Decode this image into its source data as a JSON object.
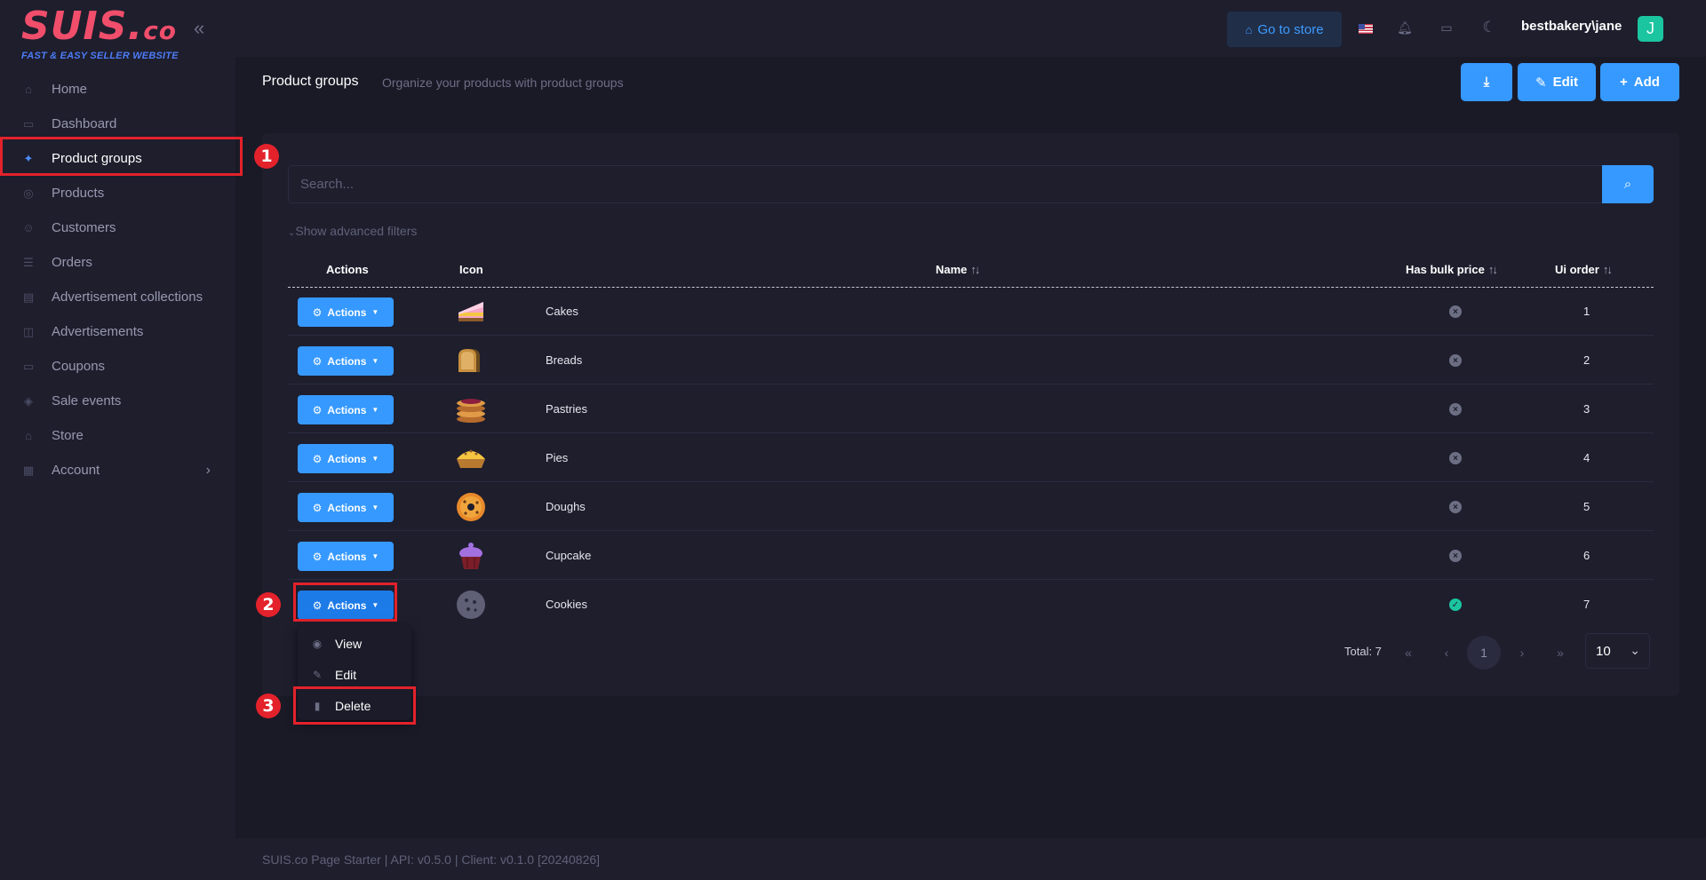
{
  "brand": {
    "logo_main": "SUIS.",
    "logo_co": "co",
    "tagline": "FAST & EASY SELLER WEBSITE"
  },
  "sidebar": {
    "items": [
      {
        "label": "Home",
        "icon": "home-icon"
      },
      {
        "label": "Dashboard",
        "icon": "dashboard-icon"
      },
      {
        "label": "Product groups",
        "icon": "product-groups-icon",
        "active": true
      },
      {
        "label": "Products",
        "icon": "products-icon"
      },
      {
        "label": "Customers",
        "icon": "customers-icon"
      },
      {
        "label": "Orders",
        "icon": "orders-icon"
      },
      {
        "label": "Advertisement collections",
        "icon": "ad-collections-icon"
      },
      {
        "label": "Advertisements",
        "icon": "advertisements-icon"
      },
      {
        "label": "Coupons",
        "icon": "coupons-icon"
      },
      {
        "label": "Sale events",
        "icon": "sale-events-icon"
      },
      {
        "label": "Store",
        "icon": "store-icon"
      },
      {
        "label": "Account",
        "icon": "account-icon"
      }
    ]
  },
  "topbar": {
    "store_label": "Go to store",
    "username": "bestbakery\\jane",
    "avatar_letter": "J"
  },
  "page": {
    "title": "Product groups",
    "subtitle": "Organize your products with product groups",
    "edit_label": "Edit",
    "add_label": "Add"
  },
  "search": {
    "placeholder": "Search...",
    "advanced_filters": "Show advanced filters"
  },
  "table": {
    "columns": {
      "actions": "Actions",
      "icon": "Icon",
      "name": "Name",
      "bulk": "Has bulk price",
      "order": "Ui order"
    },
    "action_label": "Actions",
    "rows": [
      {
        "name": "Cakes",
        "icon": "cake-icon",
        "has_bulk_price": false,
        "ui_order": "1"
      },
      {
        "name": "Breads",
        "icon": "bread-icon",
        "has_bulk_price": false,
        "ui_order": "2"
      },
      {
        "name": "Pastries",
        "icon": "pancakes-icon",
        "has_bulk_price": false,
        "ui_order": "3"
      },
      {
        "name": "Pies",
        "icon": "pie-icon",
        "has_bulk_price": false,
        "ui_order": "4"
      },
      {
        "name": "Doughs",
        "icon": "donut-icon",
        "has_bulk_price": false,
        "ui_order": "5"
      },
      {
        "name": "Cupcake",
        "icon": "cupcake-icon",
        "has_bulk_price": false,
        "ui_order": "6"
      },
      {
        "name": "Cookies",
        "icon": "cookie-icon",
        "has_bulk_price": true,
        "ui_order": "7"
      }
    ]
  },
  "dropdown": {
    "view": "View",
    "edit": "Edit",
    "delete": "Delete"
  },
  "pagination": {
    "total": "Total: 7",
    "current_page": "1",
    "page_size": "10"
  },
  "markers": [
    "1",
    "2",
    "3"
  ],
  "footer": {
    "text": "SUIS.co Page Starter | API: v0.5.0 | Client: v0.1.0 [20240826]"
  },
  "colors": {
    "accent": "#3699ff",
    "highlight": "#e3222b",
    "success": "#1bc5a0",
    "background": "#1a1a27",
    "panel": "#1e1e2d"
  }
}
